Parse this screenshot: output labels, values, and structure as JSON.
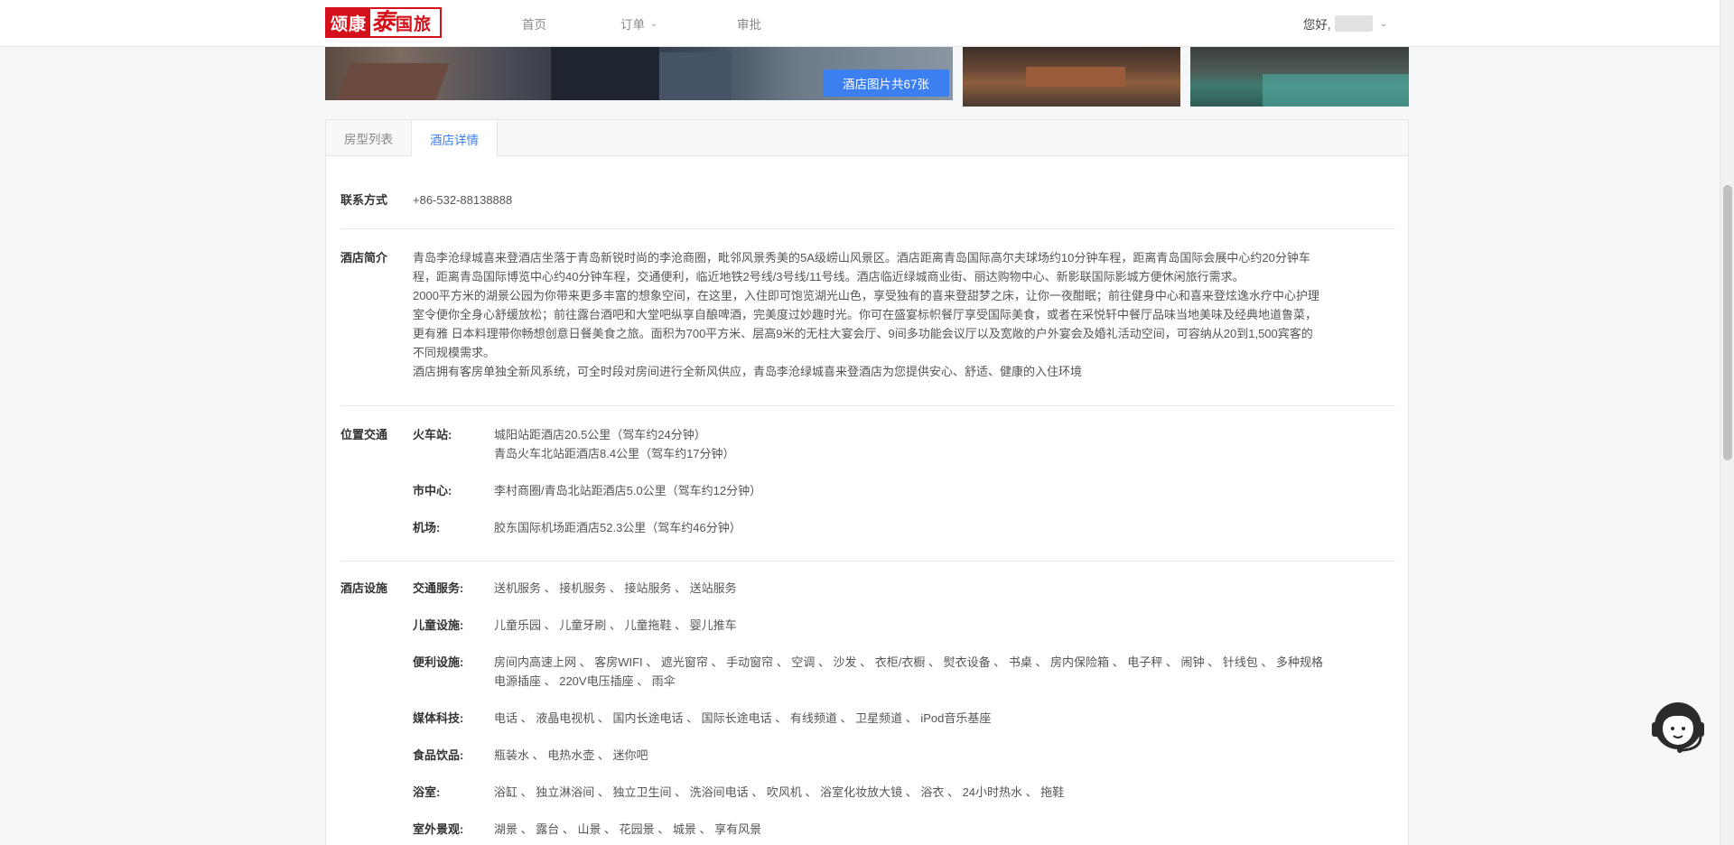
{
  "header": {
    "logo": {
      "part1": "颂康",
      "mark": "泰",
      "part2": "国旅"
    },
    "nav": {
      "home": "首页",
      "orders": "订单",
      "approve": "审批"
    },
    "greeting": "您好,"
  },
  "photos": {
    "view_all_label": "酒店图片共67张"
  },
  "tabs": {
    "room_list": "房型列表",
    "hotel_detail": "酒店详情"
  },
  "contact": {
    "label": "联系方式",
    "value": "+86-532-88138888"
  },
  "intro": {
    "label": "酒店简介",
    "lines": [
      "青岛李沧绿城喜来登酒店坐落于青岛新锐时尚的李沧商圈，毗邻风景秀美的5A级崂山风景区。酒店距离青岛国际高尔夫球场约10分钟车程，距离青岛国际会展中心约20分钟车",
      "程，距离青岛国际博览中心约40分钟车程，交通便利，临近地铁2号线/3号线/11号线。酒店临近绿城商业街、丽达购物中心、新影联国际影城方便休闲旅行需求。",
      "2000平方米的湖景公园为你带来更多丰富的想象空间，在这里，入住即可饱览湖光山色，享受独有的喜来登甜梦之床，让你一夜酣眠；前往健身中心和喜来登炫逸水疗中心护理",
      "室令便你全身心舒缓放松；前往露台酒吧和大堂吧纵享自酿啤酒，完美度过妙趣时光。你可在盛宴标帜餐厅享受国际美食，或者在采悦轩中餐厅品味当地美味及经典地道鲁菜，",
      "更有雅 日本料理带你畅想创意日餐美食之旅。面积为700平方米、层高9米的无柱大宴会厅、9间多功能会议厅以及宽敞的户外宴会及婚礼活动空间，可容纳从20到1,500宾客的",
      "不同规模需求。",
      "酒店拥有客房单独全新风系统，可全时段对房间进行全新风供应，青岛李沧绿城喜来登酒店为您提供安心、舒适、健康的入住环境"
    ]
  },
  "location": {
    "label": "位置交通",
    "train": {
      "key": "火车站:",
      "lines": [
        "城阳站距酒店20.5公里（驾车约24分钟）",
        "青岛火车北站距酒店8.4公里（驾车约17分钟）"
      ]
    },
    "center": {
      "key": "市中心:",
      "lines": [
        "李村商圈/青岛北站距酒店5.0公里（驾车约12分钟）"
      ]
    },
    "airport": {
      "key": "机场:",
      "lines": [
        "胶东国际机场距酒店52.3公里（驾车约46分钟）"
      ]
    }
  },
  "facilities": {
    "label": "酒店设施",
    "transport": {
      "key": "交通服务:",
      "lines": [
        "送机服务 、 接机服务 、 接站服务 、 送站服务"
      ]
    },
    "children": {
      "key": "儿童设施:",
      "lines": [
        "儿童乐园 、 儿童牙刷 、 儿童拖鞋 、 婴儿推车"
      ]
    },
    "convenience": {
      "key": "便利设施:",
      "lines": [
        "房间内高速上网 、 客房WIFI 、 遮光窗帘 、 手动窗帘 、 空调 、 沙发 、 衣柜/衣橱 、 熨衣设备 、 书桌 、 房内保险箱 、 电子秤 、 闹钟 、 针线包 、 多种规格",
        "电源插座 、 220V电压插座 、 雨伞"
      ]
    },
    "media": {
      "key": "媒体科技:",
      "lines": [
        "电话 、 液晶电视机 、 国内长途电话 、 国际长途电话 、 有线频道 、 卫星频道 、 iPod音乐基座"
      ]
    },
    "food": {
      "key": "食品饮品:",
      "lines": [
        "瓶装水 、 电热水壶 、 迷你吧"
      ]
    },
    "bath": {
      "key": "浴室:",
      "lines": [
        "浴缸 、 独立淋浴间 、 独立卫生间 、 洗浴间电话 、 吹风机 、 浴室化妆放大镜 、 浴衣 、 24小时热水 、 拖鞋"
      ]
    },
    "outdoor": {
      "key": "室外景观:",
      "lines": [
        "湖景 、 露台 、 山景 、 花园景 、 城景 、 享有风景"
      ]
    }
  }
}
